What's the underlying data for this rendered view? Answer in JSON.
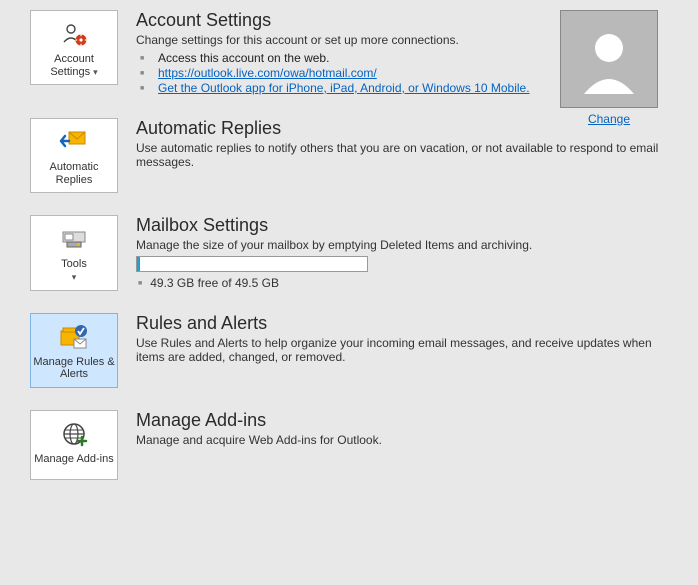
{
  "sections": {
    "account": {
      "tile_label": "Account Settings",
      "tile_arrow": "▾",
      "title": "Account Settings",
      "desc": "Change settings for this account or set up more connections.",
      "bullets": {
        "b0": "Access this account on the web.",
        "b1": "https://outlook.live.com/owa/hotmail.com/",
        "b2": "Get the Outlook app for iPhone, iPad, Android, or Windows 10 Mobile."
      },
      "change_link": "Change"
    },
    "auto": {
      "tile_label": "Automatic Replies",
      "title": "Automatic Replies",
      "desc": "Use automatic replies to notify others that you are on vacation, or not available to respond to email messages."
    },
    "mailbox": {
      "tile_label": "Tools",
      "tile_arrow": "▾",
      "title": "Mailbox Settings",
      "desc": "Manage the size of your mailbox by emptying Deleted Items and archiving.",
      "storage_text": "49.3 GB free of 49.5 GB"
    },
    "rules": {
      "tile_label": "Manage Rules & Alerts",
      "title": "Rules and Alerts",
      "desc": "Use Rules and Alerts to help organize your incoming email messages, and receive updates when items are added, changed, or removed."
    },
    "addins": {
      "tile_label": "Manage Add-ins",
      "title": "Manage Add-ins",
      "desc": "Manage and acquire Web Add-ins for Outlook."
    }
  }
}
